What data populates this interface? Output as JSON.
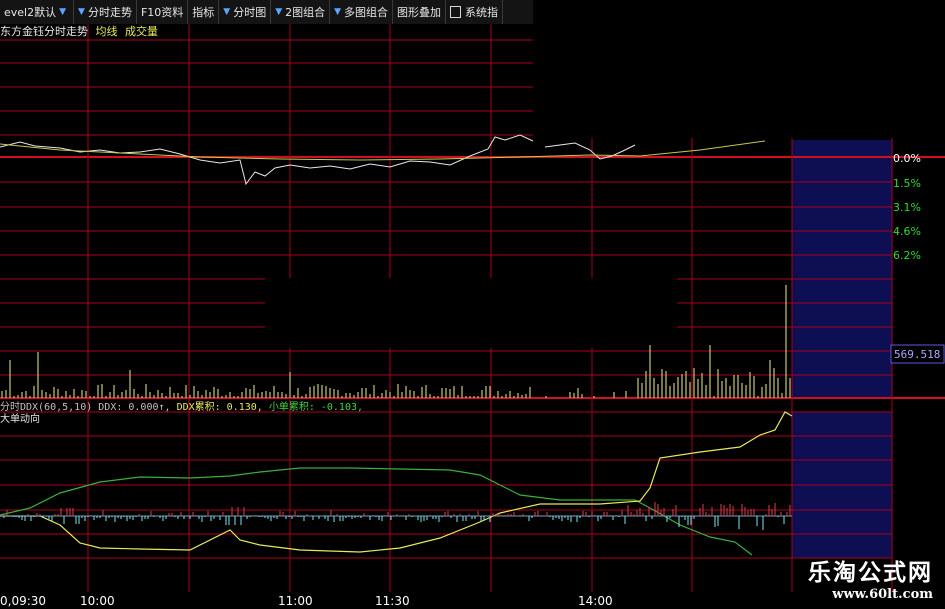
{
  "toolbar": [
    {
      "label": "evel2默认",
      "arrow": true
    },
    {
      "label": "分时走势",
      "arrow": true
    },
    {
      "label": "F10资料",
      "arrow": false
    },
    {
      "label": "指标",
      "arrow": false
    },
    {
      "label": "分时图",
      "arrow": true
    },
    {
      "label": "2图组合",
      "arrow": true
    },
    {
      "label": "多图组合",
      "arrow": true
    },
    {
      "label": "图形叠加",
      "arrow": false
    },
    {
      "label": "系统指",
      "arrow": false,
      "lock": true
    }
  ],
  "price_panel": {
    "title": "东方金钰分时走势",
    "avg_label": "均线",
    "vol_label": "成交量",
    "pct_labels": [
      "0.0%",
      "1.5%",
      "3.1%",
      "4.6%",
      "6.2%"
    ]
  },
  "volume_panel": {
    "max_value": "569.518"
  },
  "ddx_panel": {
    "indicator_name": "分时DDX(60,5,10)",
    "ddx_text": "DDX: 0.000↑,",
    "ddx_cum_text": "DDX累积: 0.130,",
    "small_cum_text": "小单累积: -0.103,",
    "flow_label": "大单动向"
  },
  "time_axis": [
    "0,09:30",
    "10:00",
    "11:00",
    "11:30",
    "14:00"
  ],
  "watermark": {
    "brand": "乐淘公式网",
    "url": "www.60lt.com"
  },
  "colors": {
    "grid_red": "#a8001e",
    "price_line": "#e8e8e8",
    "avg_line": "#c8c850",
    "volume_bar": "#c8c870",
    "pct_green": "#2edc2e",
    "ddx_label": "#c0c0c0",
    "ddx_cum": "#e8e85a",
    "small_cum": "#3ad83a",
    "upper_line": "#3ab03a",
    "lower_line": "#c8c850",
    "bar_red": "#dc4050",
    "bar_cyan": "#78e8f0",
    "value_box_text": "#a8a8ff",
    "forecast_fill": "#101060"
  }
}
